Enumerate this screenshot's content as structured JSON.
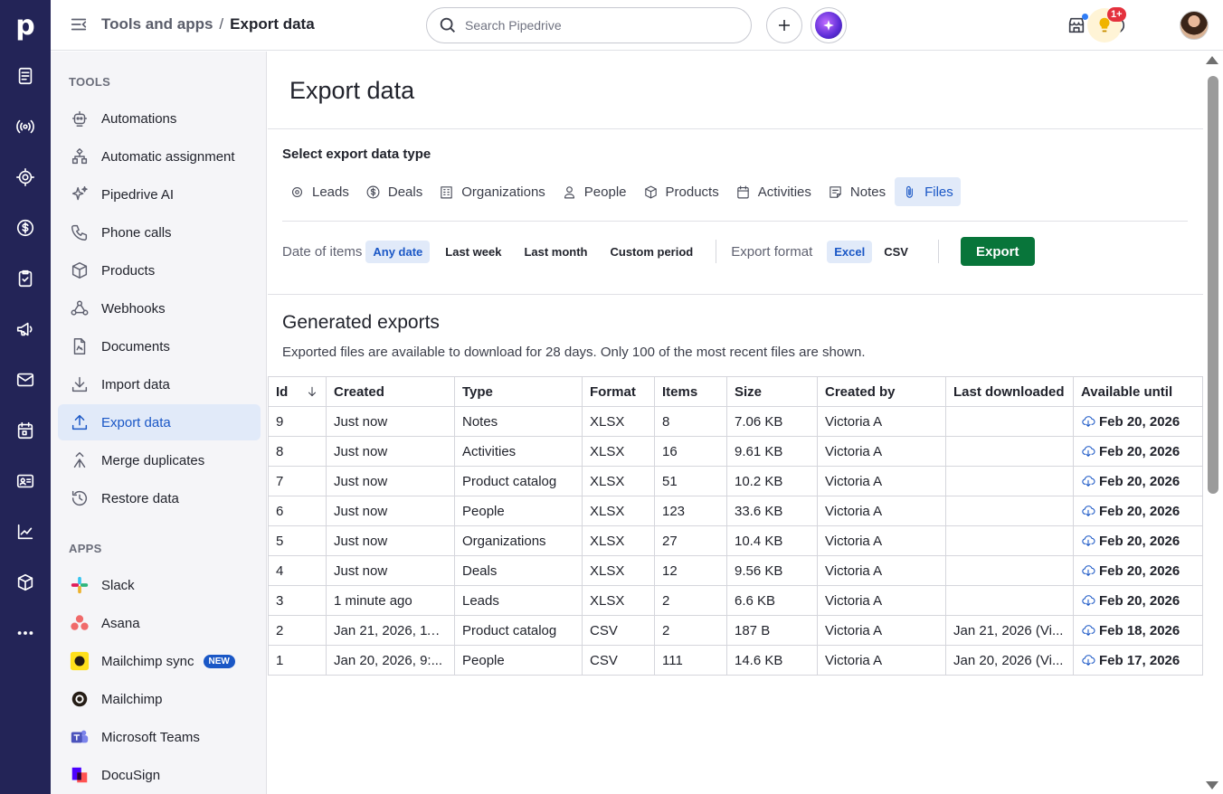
{
  "app": {
    "logo_letter": "p"
  },
  "topbar": {
    "breadcrumb_parent": "Tools and apps",
    "breadcrumb_sep": "/",
    "breadcrumb_current": "Export data",
    "search_placeholder": "Search Pipedrive",
    "notification_badge": "1+"
  },
  "rail": {
    "icons": [
      "leads-inbox-icon",
      "campaigns-broadcast-icon",
      "deals-target-icon",
      "dollar-icon",
      "activities-icon",
      "megaphone-icon",
      "mail-icon",
      "calendar-icon",
      "contacts-icon",
      "insights-icon",
      "products-icon",
      "more-icon"
    ]
  },
  "sidenav": {
    "tools_heading": "TOOLS",
    "tools": [
      {
        "label": "Automations",
        "icon": "robot-icon"
      },
      {
        "label": "Automatic assignment",
        "icon": "assignment-icon"
      },
      {
        "label": "Pipedrive AI",
        "icon": "sparkle-icon"
      },
      {
        "label": "Phone calls",
        "icon": "phone-icon"
      },
      {
        "label": "Products",
        "icon": "box-icon"
      },
      {
        "label": "Webhooks",
        "icon": "webhook-icon"
      },
      {
        "label": "Documents",
        "icon": "document-icon"
      },
      {
        "label": "Import data",
        "icon": "download-tray-icon"
      },
      {
        "label": "Export data",
        "icon": "upload-tray-icon",
        "active": true
      },
      {
        "label": "Merge duplicates",
        "icon": "merge-icon"
      },
      {
        "label": "Restore data",
        "icon": "restore-icon"
      }
    ],
    "apps_heading": "APPS",
    "apps": [
      {
        "label": "Slack",
        "icon": "slack-logo"
      },
      {
        "label": "Asana",
        "icon": "asana-logo"
      },
      {
        "label": "Mailchimp sync",
        "icon": "mailchimp-logo",
        "badge": "NEW"
      },
      {
        "label": "Mailchimp",
        "icon": "mailchimp-logo"
      },
      {
        "label": "Microsoft Teams",
        "icon": "teams-logo"
      },
      {
        "label": "DocuSign",
        "icon": "docusign-logo"
      }
    ]
  },
  "main": {
    "title": "Export data",
    "select_label": "Select export data type",
    "types": [
      {
        "label": "Leads",
        "icon": "target-icon"
      },
      {
        "label": "Deals",
        "icon": "dollar-icon"
      },
      {
        "label": "Organizations",
        "icon": "building-icon"
      },
      {
        "label": "People",
        "icon": "person-icon"
      },
      {
        "label": "Products",
        "icon": "box-icon"
      },
      {
        "label": "Activities",
        "icon": "calendar-icon"
      },
      {
        "label": "Notes",
        "icon": "note-icon"
      },
      {
        "label": "Files",
        "icon": "paperclip-icon",
        "active": true
      }
    ],
    "date_label": "Date of items",
    "date_options": [
      "Any date",
      "Last week",
      "Last month",
      "Custom period"
    ],
    "format_label": "Export format",
    "format_options": [
      "Excel",
      "CSV"
    ],
    "export_button": "Export",
    "generated_title": "Generated exports",
    "generated_subtitle": "Exported files are available to download for 28 days. Only 100 of the most recent files are shown."
  },
  "table": {
    "columns": [
      "Id",
      "Created",
      "Type",
      "Format",
      "Items",
      "Size",
      "Created by",
      "Last downloaded",
      "Available until"
    ],
    "rows": [
      [
        "9",
        "Just now",
        "Notes",
        "XLSX",
        "8",
        "7.06 KB",
        "Victoria A",
        "",
        "Feb 20, 2026"
      ],
      [
        "8",
        "Just now",
        "Activities",
        "XLSX",
        "16",
        "9.61 KB",
        "Victoria A",
        "",
        "Feb 20, 2026"
      ],
      [
        "7",
        "Just now",
        "Product catalog",
        "XLSX",
        "51",
        "10.2 KB",
        "Victoria A",
        "",
        "Feb 20, 2026"
      ],
      [
        "6",
        "Just now",
        "People",
        "XLSX",
        "123",
        "33.6 KB",
        "Victoria A",
        "",
        "Feb 20, 2026"
      ],
      [
        "5",
        "Just now",
        "Organizations",
        "XLSX",
        "27",
        "10.4 KB",
        "Victoria A",
        "",
        "Feb 20, 2026"
      ],
      [
        "4",
        "Just now",
        "Deals",
        "XLSX",
        "12",
        "9.56 KB",
        "Victoria A",
        "",
        "Feb 20, 2026"
      ],
      [
        "3",
        "1 minute ago",
        "Leads",
        "XLSX",
        "2",
        "6.6 KB",
        "Victoria A",
        "",
        "Feb 20, 2026"
      ],
      [
        "2",
        "Jan 21, 2026, 11:...",
        "Product catalog",
        "CSV",
        "2",
        "187 B",
        "Victoria A",
        "Jan 21, 2026 (Vi...",
        "Feb 18, 2026"
      ],
      [
        "1",
        "Jan 20, 2026, 9:...",
        "People",
        "CSV",
        "111",
        "14.6 KB",
        "Victoria A",
        "Jan 20, 2026 (Vi...",
        "Feb 17, 2026"
      ]
    ]
  }
}
